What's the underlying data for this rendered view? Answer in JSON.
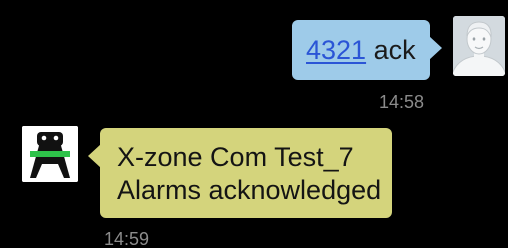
{
  "messages": {
    "outgoing": {
      "link_text": "4321",
      "text": " ack",
      "time": "14:58",
      "bubble_color": "#9ecbe9",
      "link_color": "#2b55d6",
      "avatar_icon": "default-person-avatar-icon"
    },
    "incoming": {
      "line1": "X-zone Com Test_7",
      "line2": "Alarms acknowledged",
      "time": "14:59",
      "bubble_color": "#d4d47c",
      "avatar_icon": "x-zone-alarm-logo-icon"
    }
  }
}
